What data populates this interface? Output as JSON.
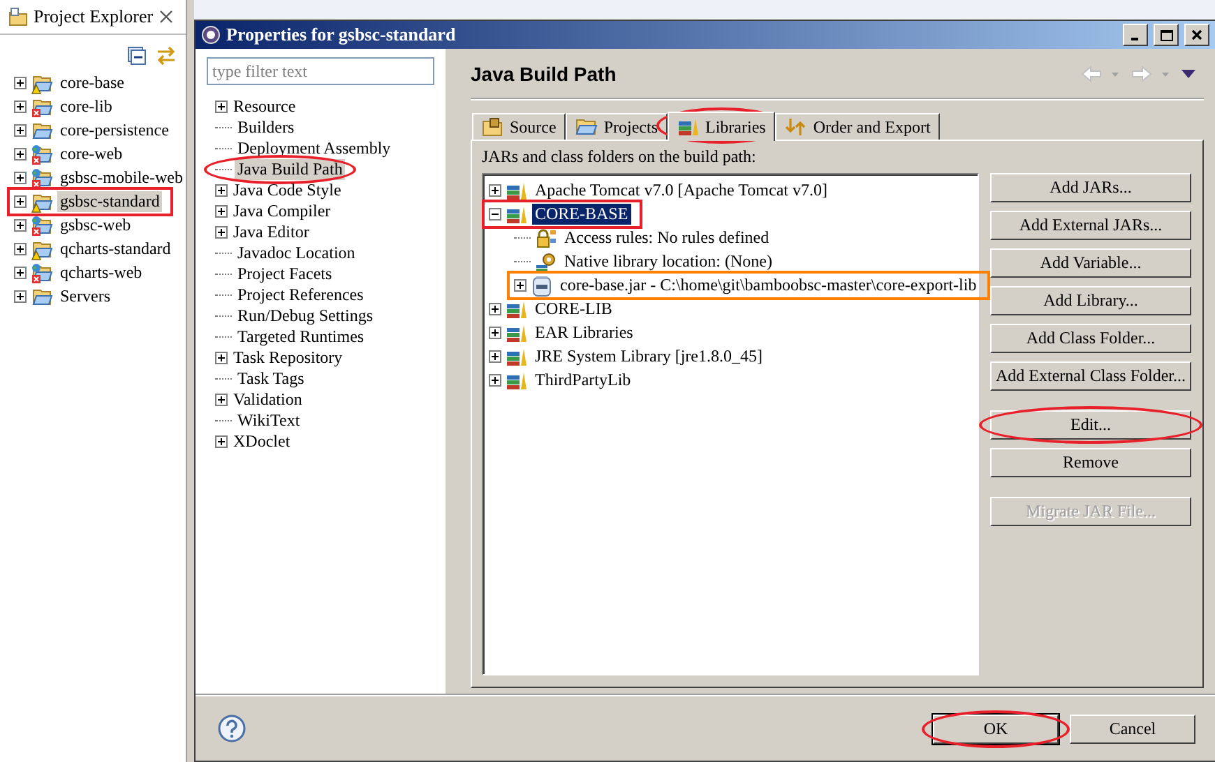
{
  "explorer": {
    "title": "Project Explorer",
    "projects": [
      {
        "name": "core-base",
        "kind": "project",
        "warning": true,
        "error": false,
        "selected": false
      },
      {
        "name": "core-lib",
        "kind": "project",
        "warning": false,
        "error": true,
        "selected": false
      },
      {
        "name": "core-persistence",
        "kind": "project",
        "warning": false,
        "error": false,
        "selected": false
      },
      {
        "name": "core-web",
        "kind": "web",
        "warning": false,
        "error": true,
        "selected": false
      },
      {
        "name": "gsbsc-mobile-web",
        "kind": "web",
        "warning": false,
        "error": true,
        "selected": false
      },
      {
        "name": "gsbsc-standard",
        "kind": "project",
        "warning": true,
        "error": false,
        "selected": true,
        "boxed": true,
        "color": "#e8202a"
      },
      {
        "name": "gsbsc-web",
        "kind": "web",
        "warning": false,
        "error": true,
        "selected": false
      },
      {
        "name": "qcharts-standard",
        "kind": "project",
        "warning": true,
        "error": false,
        "selected": false
      },
      {
        "name": "qcharts-web",
        "kind": "web",
        "warning": false,
        "error": true,
        "selected": false
      },
      {
        "name": "Servers",
        "kind": "folder",
        "warning": false,
        "error": false,
        "selected": false
      }
    ]
  },
  "dialog": {
    "title": "Properties for gsbsc-standard",
    "filter": {
      "placeholder": "type filter text"
    },
    "nav": [
      {
        "label": "Resource",
        "expandable": true,
        "selected": false
      },
      {
        "label": "Builders",
        "expandable": false,
        "selected": false
      },
      {
        "label": "Deployment Assembly",
        "expandable": false,
        "selected": false
      },
      {
        "label": "Java Build Path",
        "expandable": false,
        "selected": true,
        "circled": true,
        "color": "#e8202a"
      },
      {
        "label": "Java Code Style",
        "expandable": true,
        "selected": false
      },
      {
        "label": "Java Compiler",
        "expandable": true,
        "selected": false
      },
      {
        "label": "Java Editor",
        "expandable": true,
        "selected": false
      },
      {
        "label": "Javadoc Location",
        "expandable": false,
        "selected": false
      },
      {
        "label": "Project Facets",
        "expandable": false,
        "selected": false
      },
      {
        "label": "Project References",
        "expandable": false,
        "selected": false
      },
      {
        "label": "Run/Debug Settings",
        "expandable": false,
        "selected": false
      },
      {
        "label": "Targeted Runtimes",
        "expandable": false,
        "selected": false
      },
      {
        "label": "Task Repository",
        "expandable": true,
        "selected": false
      },
      {
        "label": "Task Tags",
        "expandable": false,
        "selected": false
      },
      {
        "label": "Validation",
        "expandable": true,
        "selected": false
      },
      {
        "label": "WikiText",
        "expandable": false,
        "selected": false
      },
      {
        "label": "XDoclet",
        "expandable": true,
        "selected": false
      }
    ],
    "page_title": "Java Build Path",
    "tabs": [
      {
        "label": "Source",
        "kind": "source",
        "selected": false
      },
      {
        "label": "Projects",
        "kind": "projects",
        "selected": false
      },
      {
        "label": "Libraries",
        "kind": "libraries",
        "selected": true,
        "circled": true,
        "color": "#e8202a"
      },
      {
        "label": "Order and Export",
        "kind": "order",
        "selected": false
      }
    ],
    "list_label": "JARs and class folders on the build path:",
    "libraries": [
      {
        "label": "Apache Tomcat v7.0 [Apache Tomcat v7.0]",
        "kind": "library",
        "expanded": false,
        "selected": false
      },
      {
        "label": "CORE-BASE",
        "kind": "library",
        "expanded": true,
        "selected": true,
        "boxed": true,
        "color": "#e8202a",
        "children": [
          {
            "label": "Access rules: No rules defined",
            "kind": "access",
            "selected": false
          },
          {
            "label": "Native library location: (None)",
            "kind": "native",
            "selected": false
          },
          {
            "label": "core-base.jar - C:\\home\\git\\bamboobsc-master\\core-export-lib",
            "kind": "jar",
            "expanded": false,
            "selected": false,
            "boxed": true,
            "color": "#ff8000"
          }
        ]
      },
      {
        "label": "CORE-LIB",
        "kind": "library",
        "expanded": false,
        "selected": false
      },
      {
        "label": "EAR Libraries",
        "kind": "library",
        "expanded": false,
        "selected": false
      },
      {
        "label": "JRE System Library [jre1.8.0_45]",
        "kind": "library",
        "expanded": false,
        "selected": false
      },
      {
        "label": "ThirdPartyLib",
        "kind": "library",
        "expanded": false,
        "selected": false
      }
    ],
    "button_groups": [
      [
        {
          "label": "Add JARs...",
          "disabled": false
        },
        {
          "label": "Add External JARs...",
          "disabled": false
        },
        {
          "label": "Add Variable...",
          "disabled": false
        },
        {
          "label": "Add Library...",
          "disabled": false
        },
        {
          "label": "Add Class Folder...",
          "disabled": false
        },
        {
          "label": "Add External Class Folder...",
          "disabled": false
        }
      ],
      [
        {
          "label": "Edit...",
          "disabled": false,
          "circled": true,
          "color": "#e8202a"
        },
        {
          "label": "Remove",
          "disabled": false
        }
      ],
      [
        {
          "label": "Migrate JAR File...",
          "disabled": true
        }
      ]
    ],
    "footer_buttons": [
      {
        "label": "OK",
        "default": true,
        "circled": true,
        "color": "#e8202a"
      },
      {
        "label": "Cancel",
        "default": false
      }
    ]
  }
}
